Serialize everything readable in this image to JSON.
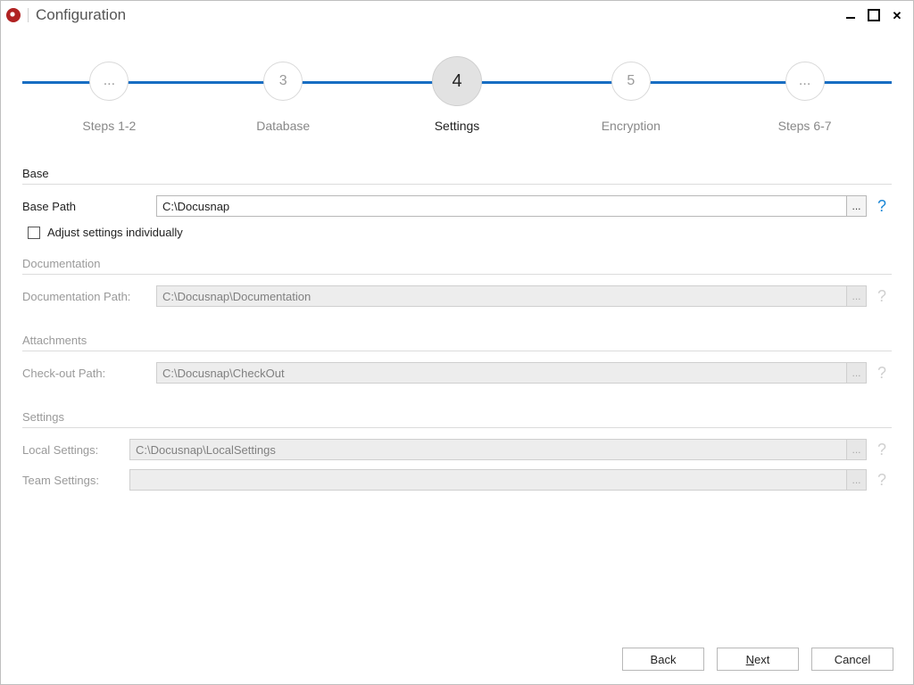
{
  "title": "Configuration",
  "stepper": {
    "steps": [
      {
        "num": "...",
        "label": "Steps 1-2"
      },
      {
        "num": "3",
        "label": "Database"
      },
      {
        "num": "4",
        "label": "Settings"
      },
      {
        "num": "5",
        "label": "Encryption"
      },
      {
        "num": "...",
        "label": "Steps 6-7"
      }
    ],
    "active_index": 2
  },
  "sections": {
    "base": {
      "title": "Base",
      "base_path_label": "Base Path",
      "base_path_value": "C:\\Docusnap",
      "adjust_label": "Adjust settings individually",
      "adjust_checked": false
    },
    "documentation": {
      "title": "Documentation",
      "doc_path_label": "Documentation Path:",
      "doc_path_value": "C:\\Docusnap\\Documentation"
    },
    "attachments": {
      "title": "Attachments",
      "checkout_label": "Check-out Path:",
      "checkout_value": "C:\\Docusnap\\CheckOut"
    },
    "settings": {
      "title": "Settings",
      "local_label": "Local Settings:",
      "local_value": "C:\\Docusnap\\LocalSettings",
      "team_label": "Team Settings:",
      "team_value": ""
    }
  },
  "buttons": {
    "back": "Back",
    "next_prefix": "N",
    "next_suffix": "ext",
    "cancel": "Cancel"
  },
  "browse_glyph": "...",
  "help_glyph": "?"
}
